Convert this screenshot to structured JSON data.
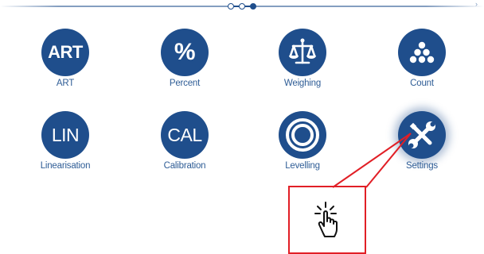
{
  "pager": {
    "pages": 3,
    "active_index": 2
  },
  "corner_mark": "›",
  "tiles": [
    {
      "label": "ART",
      "icon": "art-text-icon",
      "icon_text": "ART"
    },
    {
      "label": "Percent",
      "icon": "percent-icon",
      "icon_text": "%"
    },
    {
      "label": "Weighing",
      "icon": "balance-scale-icon"
    },
    {
      "label": "Count",
      "icon": "count-dots-icon"
    },
    {
      "label": "Linearisation",
      "icon": "lin-text-icon",
      "icon_text": "LIN"
    },
    {
      "label": "Calibration",
      "icon": "cal-text-icon",
      "icon_text": "CAL"
    },
    {
      "label": "Levelling",
      "icon": "level-rings-icon"
    },
    {
      "label": "Settings",
      "icon": "wrench-screwdriver-icon",
      "highlighted": true
    }
  ],
  "annotation": {
    "icon": "tap-hand-icon",
    "color": "#e11f26"
  },
  "colors": {
    "primary": "#1f4e8c",
    "label": "#2f5d96",
    "callout": "#e11f26"
  }
}
